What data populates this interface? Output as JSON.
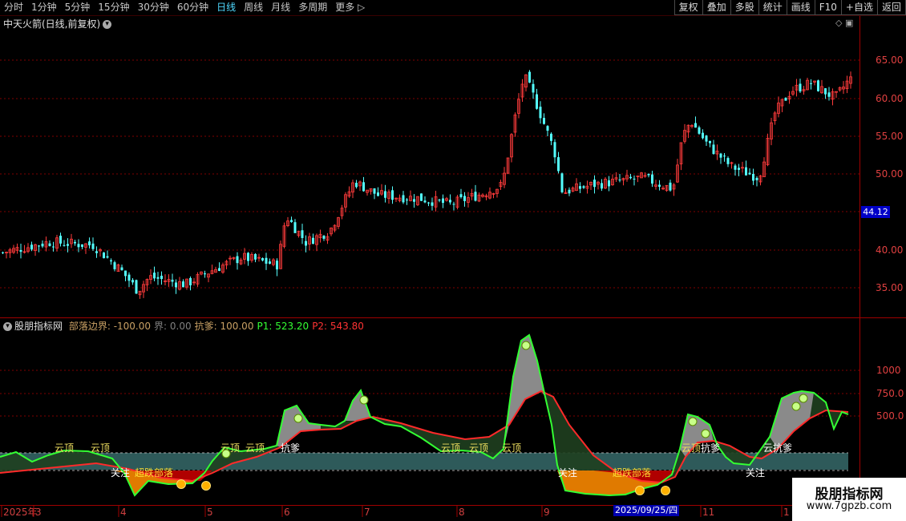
{
  "toolbar": {
    "periods": [
      "分时",
      "1分钟",
      "5分钟",
      "15分钟",
      "30分钟",
      "60分钟",
      "日线",
      "周线",
      "月线",
      "多周期",
      "更多 ▷"
    ],
    "active": "日线",
    "buttons": [
      "复权",
      "叠加",
      "多股",
      "统计",
      "画线",
      "F10",
      "+自选",
      "返回"
    ]
  },
  "main_chart": {
    "title": "中天火箭(日线,前复权)",
    "price_axis": [
      "65.00",
      "60.00",
      "55.00",
      "50.00",
      "44.12",
      "40.00",
      "35.00"
    ],
    "current_price": "44.12"
  },
  "indicator": {
    "name": "股朋指标网",
    "fields": [
      {
        "label": "部落边界: -100.00",
        "color": "#c8a064"
      },
      {
        "label": "界: 0.00",
        "color": "#808080"
      },
      {
        "label": "抗爹: 100.00",
        "color": "#c8a064"
      },
      {
        "label": "P1: 523.20",
        "color": "#33ff33"
      },
      {
        "label": "P2: 543.80",
        "color": "#ff3333"
      }
    ],
    "axis": [
      "1000",
      "750.0",
      "500.0"
    ],
    "markers": [
      "云顶",
      "云顶",
      "关注",
      "超跌部落",
      "云顶",
      "云顶",
      "抗爹",
      "云顶",
      "云顶",
      "云顶",
      "关注",
      "超跌部落",
      "云顶",
      "抗爹",
      "关注",
      "云抗爹"
    ]
  },
  "date_axis": {
    "labels": [
      "2025年",
      "3",
      "4",
      "5",
      "6",
      "7",
      "8",
      "9",
      "11",
      "1"
    ],
    "highlight": "2025/09/25/四"
  },
  "watermark": {
    "line1": "股朋指标网",
    "line2": "www.7gpzb.com"
  },
  "colors": {
    "up": "#ff3b3b",
    "down": "#54ffff",
    "p1": "#33ff33",
    "p2": "#ff2a2a",
    "grid": "#800000"
  }
}
